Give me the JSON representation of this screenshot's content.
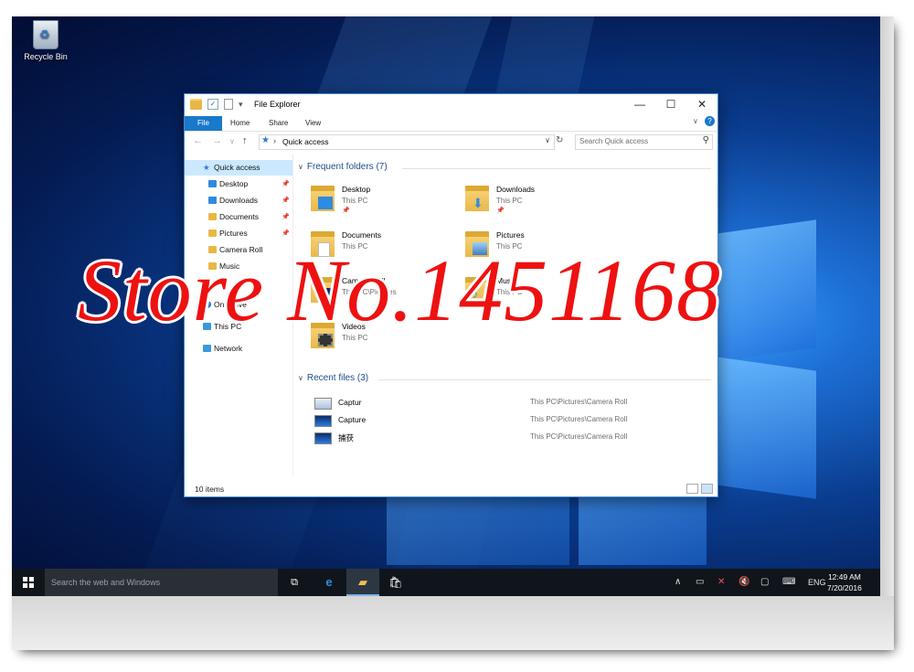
{
  "desktop": {
    "recycle_bin_label": "Recycle Bin"
  },
  "explorer": {
    "title": "File Explorer",
    "ribbon_tabs": [
      "File",
      "Home",
      "Share",
      "View"
    ],
    "address": {
      "location": "Quick access"
    },
    "search": {
      "placeholder": "Search Quick access"
    },
    "nav_pane": {
      "items": [
        {
          "label": "Quick access",
          "icon": "star-icon",
          "pinned": false
        },
        {
          "label": "Desktop",
          "icon": "folder-icon",
          "pinned": true
        },
        {
          "label": "Downloads",
          "icon": "download-folder-icon",
          "pinned": true
        },
        {
          "label": "Documents",
          "icon": "folder-icon",
          "pinned": true
        },
        {
          "label": "Pictures",
          "icon": "folder-icon",
          "pinned": true
        },
        {
          "label": "Camera Roll",
          "icon": "folder-icon",
          "pinned": false
        },
        {
          "label": "Music",
          "icon": "folder-icon",
          "pinned": false
        },
        {
          "label": "OneDrive",
          "icon": "cloud-icon",
          "pinned": false
        },
        {
          "label": "This PC",
          "icon": "computer-icon",
          "pinned": false
        },
        {
          "label": "Network",
          "icon": "network-icon",
          "pinned": false
        }
      ]
    },
    "frequent": {
      "header": "Frequent folders (7)",
      "folders": [
        {
          "name": "Desktop",
          "location": "This PC",
          "pinned": true
        },
        {
          "name": "Downloads",
          "location": "This PC",
          "pinned": true
        },
        {
          "name": "Documents",
          "location": "This PC",
          "pinned": false
        },
        {
          "name": "Pictures",
          "location": "This PC",
          "pinned": false
        },
        {
          "name": "Camera Roll",
          "location": "This PC\\Pictures",
          "pinned": false
        },
        {
          "name": "Music",
          "location": "This PC",
          "pinned": false
        },
        {
          "name": "Videos",
          "location": "This PC",
          "pinned": false
        }
      ]
    },
    "recent": {
      "header": "Recent files (3)",
      "files": [
        {
          "name": "Captur",
          "path": "This PC\\Pictures\\Camera Roll"
        },
        {
          "name": "Capture",
          "path": "This PC\\Pictures\\Camera Roll"
        },
        {
          "name": "捕获",
          "path": "This PC\\Pictures\\Camera Roll"
        }
      ]
    },
    "status": "10 items"
  },
  "watermark": "Store No.1451168",
  "taskbar": {
    "search_placeholder": "Search the web and Windows",
    "language": "ENG",
    "time": "12:49 AM",
    "date": "7/20/2016"
  },
  "colors": {
    "accent": "#1979ca",
    "selection": "#cce8ff",
    "watermark": "#ee1111",
    "taskbar": "#10151c"
  }
}
